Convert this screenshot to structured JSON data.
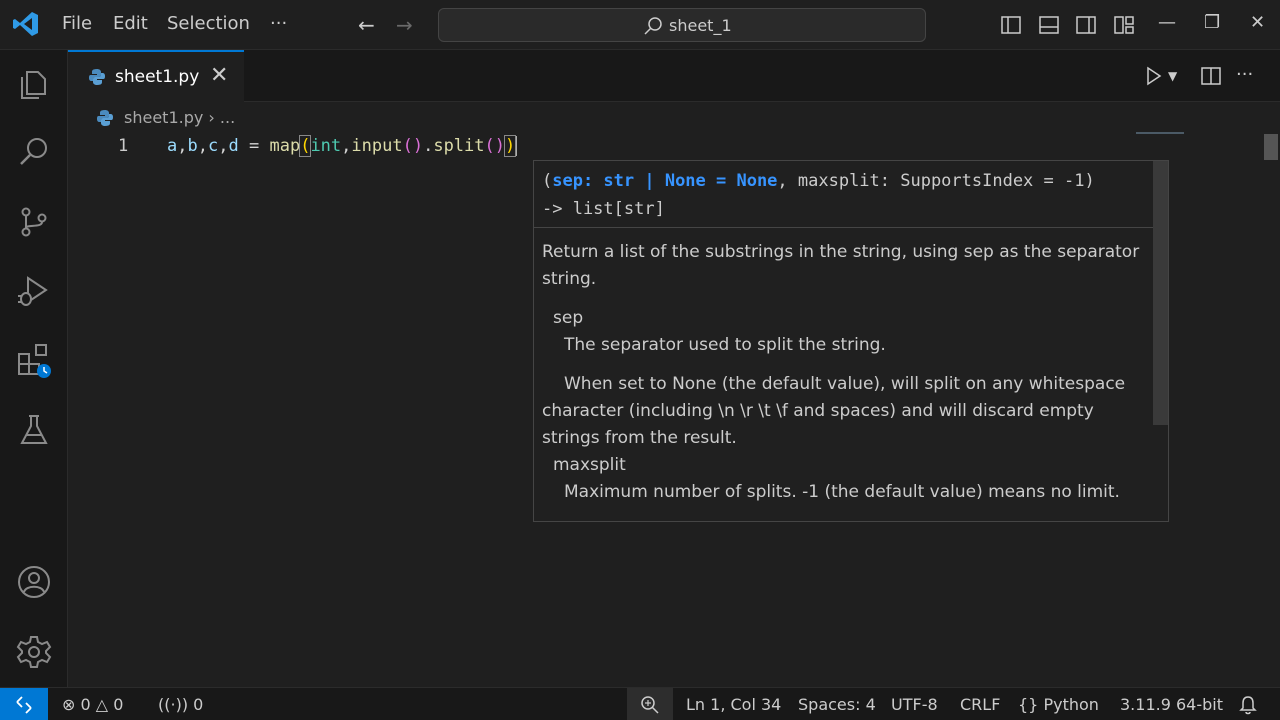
{
  "menu": [
    "File",
    "Edit",
    "Selection",
    "···"
  ],
  "command_center": {
    "text": "sheet_1"
  },
  "tab": {
    "label": "sheet1.py"
  },
  "breadcrumb": {
    "file": "sheet1.py",
    "more": "..."
  },
  "editor": {
    "line_number": "1",
    "code_tokens": [
      "a",
      ",",
      "b",
      ",",
      "c",
      ",",
      "d",
      " = ",
      "map",
      "(",
      "int",
      ",",
      "input",
      "()",
      ".",
      "split",
      "()",
      ")"
    ]
  },
  "hover": {
    "sig_open": "(",
    "sig_hl": "sep: str | None = None",
    "sig_rest": ", maxsplit: SupportsIndex = -1)",
    "sig_ret": "-> list[str]",
    "summary": "Return a list of the substrings in the string, using sep as the separator string.",
    "param1_name": "sep",
    "param1_desc": "The separator used to split the string.",
    "param1_more": "When set to None (the default value), will split on any whitespace character (including \\n \\r \\t \\f and spaces) and will discard empty strings from the result.",
    "param2_name": "maxsplit",
    "param2_desc": "Maximum number of splits. -1 (the default value) means no limit."
  },
  "status": {
    "errors": "0",
    "warnings": "0",
    "ports": "0",
    "position": "Ln 1, Col 34",
    "spaces": "Spaces: 4",
    "encoding": "UTF-8",
    "eol": "CRLF",
    "language": "Python",
    "interpreter": "3.11.9 64-bit"
  },
  "colors": {
    "accent": "#0078d4",
    "background": "#1f1f1f",
    "link": "#3794ff"
  }
}
